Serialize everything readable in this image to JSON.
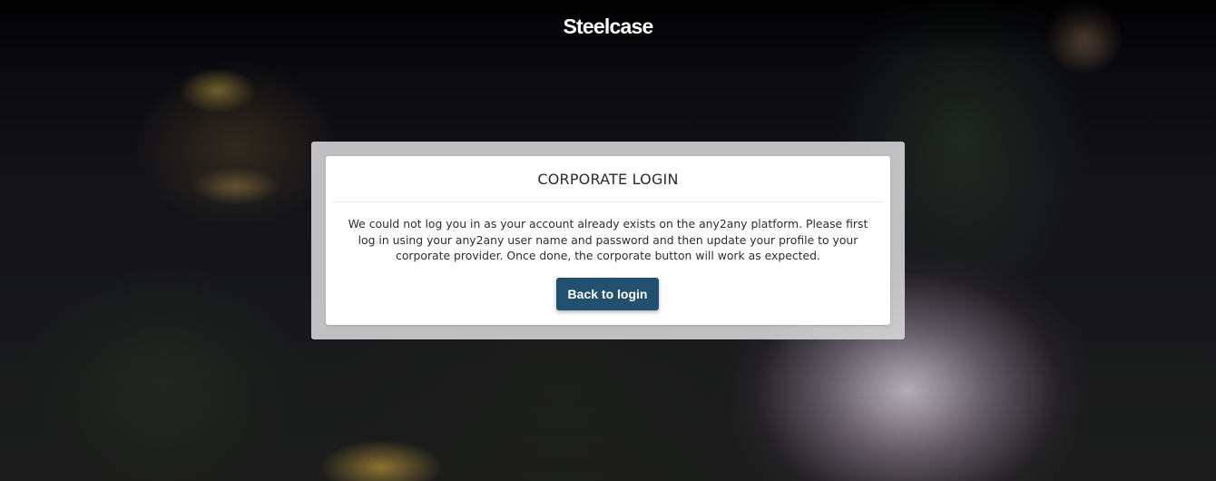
{
  "header": {
    "brand": "Steelcase"
  },
  "dialog": {
    "title": "CORPORATE LOGIN",
    "message": "We could not log you in as your account already exists on the any2any platform. Please first log in using your any2any user name and password and then update your profile to your corporate provider. Once done, the corporate button will work as expected.",
    "back_button_label": "Back to login"
  },
  "colors": {
    "button": "#22516f",
    "card": "#ffffff",
    "frame": "#d7d7da"
  }
}
